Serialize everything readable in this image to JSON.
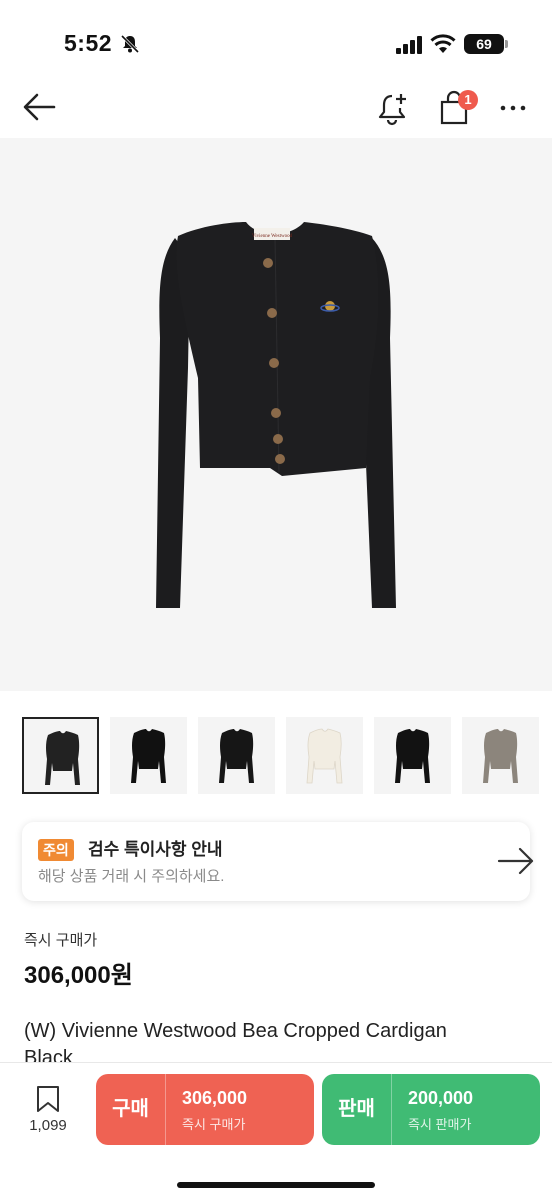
{
  "status_bar": {
    "time": "5:52",
    "battery": "69"
  },
  "nav": {
    "back_icon": "back-arrow-icon",
    "notify_icon": "bell-plus-icon",
    "bag_icon": "shopping-bag-icon",
    "bag_badge": "1",
    "more_icon": "more-icon"
  },
  "gallery": {
    "selected_index": 0,
    "thumbnails": [
      {
        "color": "#222222"
      },
      {
        "color": "#111111"
      },
      {
        "color": "#161616"
      },
      {
        "color": "#f2ede2"
      },
      {
        "color": "#121212"
      },
      {
        "color": "#8c857c"
      }
    ]
  },
  "notice": {
    "badge": "주의",
    "title": "검수 특이사항 안내",
    "subtitle": "해당 상품 거래 시 주의하세요."
  },
  "price": {
    "label": "즉시 구매가",
    "value": "306,000원"
  },
  "product": {
    "name": "(W) Vivienne Westwood Bea Cropped Cardigan Black"
  },
  "bottom_bar": {
    "wish_count": "1,099",
    "buy": {
      "label": "구매",
      "price": "306,000",
      "sub": "즉시 구매가"
    },
    "sell": {
      "label": "판매",
      "price": "200,000",
      "sub": "즉시 판매가"
    }
  },
  "colors": {
    "buy": "#ef6253",
    "sell": "#40bb74",
    "badge": "#f08a33",
    "notification": "#ef5a4d"
  }
}
